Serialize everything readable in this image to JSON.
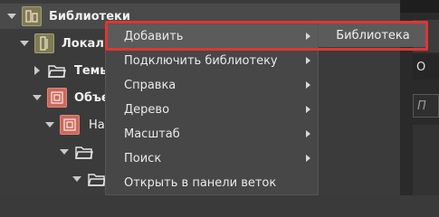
{
  "tree": {
    "root_label": "Библиотеки",
    "local_label": "Локаль",
    "themes_label": "Темы",
    "objects_label": "Объе",
    "child_label": "На"
  },
  "context_menu": {
    "items": [
      {
        "label": "Добавить",
        "has_submenu": true
      },
      {
        "label": "Подключить библиотеку",
        "has_submenu": true
      },
      {
        "label": "Справка",
        "has_submenu": true
      },
      {
        "label": "Дерево",
        "has_submenu": true
      },
      {
        "label": "Масштаб",
        "has_submenu": true
      },
      {
        "label": "Поиск",
        "has_submenu": true
      },
      {
        "label": "Открыть в панели веток",
        "has_submenu": false
      }
    ],
    "submenu": {
      "label": "Библиотека"
    }
  },
  "right_panel": {
    "letter": "О",
    "search_placeholder": "П"
  },
  "colors": {
    "highlight_box": "#e03535",
    "library_icon": "#7e7b55",
    "object_icon": "#c96a5e",
    "menu_bg": "#474747"
  }
}
